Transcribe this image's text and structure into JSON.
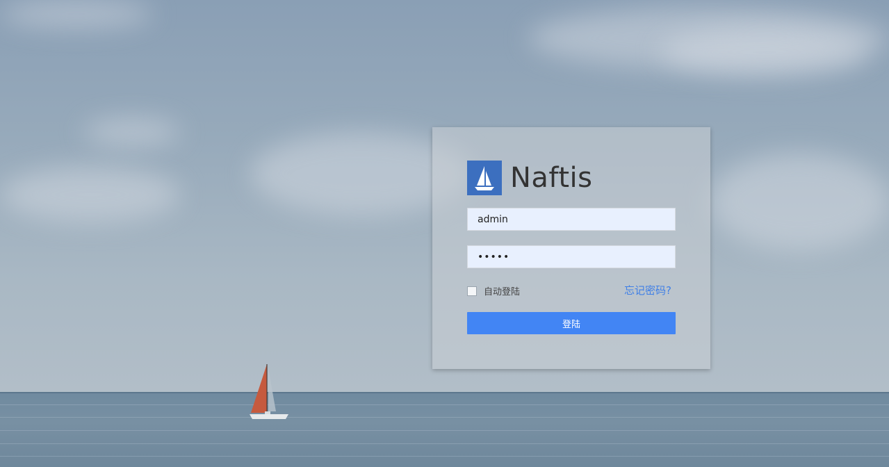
{
  "brand": {
    "name": "Naftis",
    "logo_icon": "sailboat-icon",
    "logo_color": "#3c6fbf"
  },
  "login_form": {
    "username_value": "admin",
    "password_value": "•••••",
    "remember_label": "自动登陆",
    "remember_checked": false,
    "forgot_label": "忘记密码?",
    "submit_label": "登陆",
    "accent_color": "#4285f4"
  }
}
